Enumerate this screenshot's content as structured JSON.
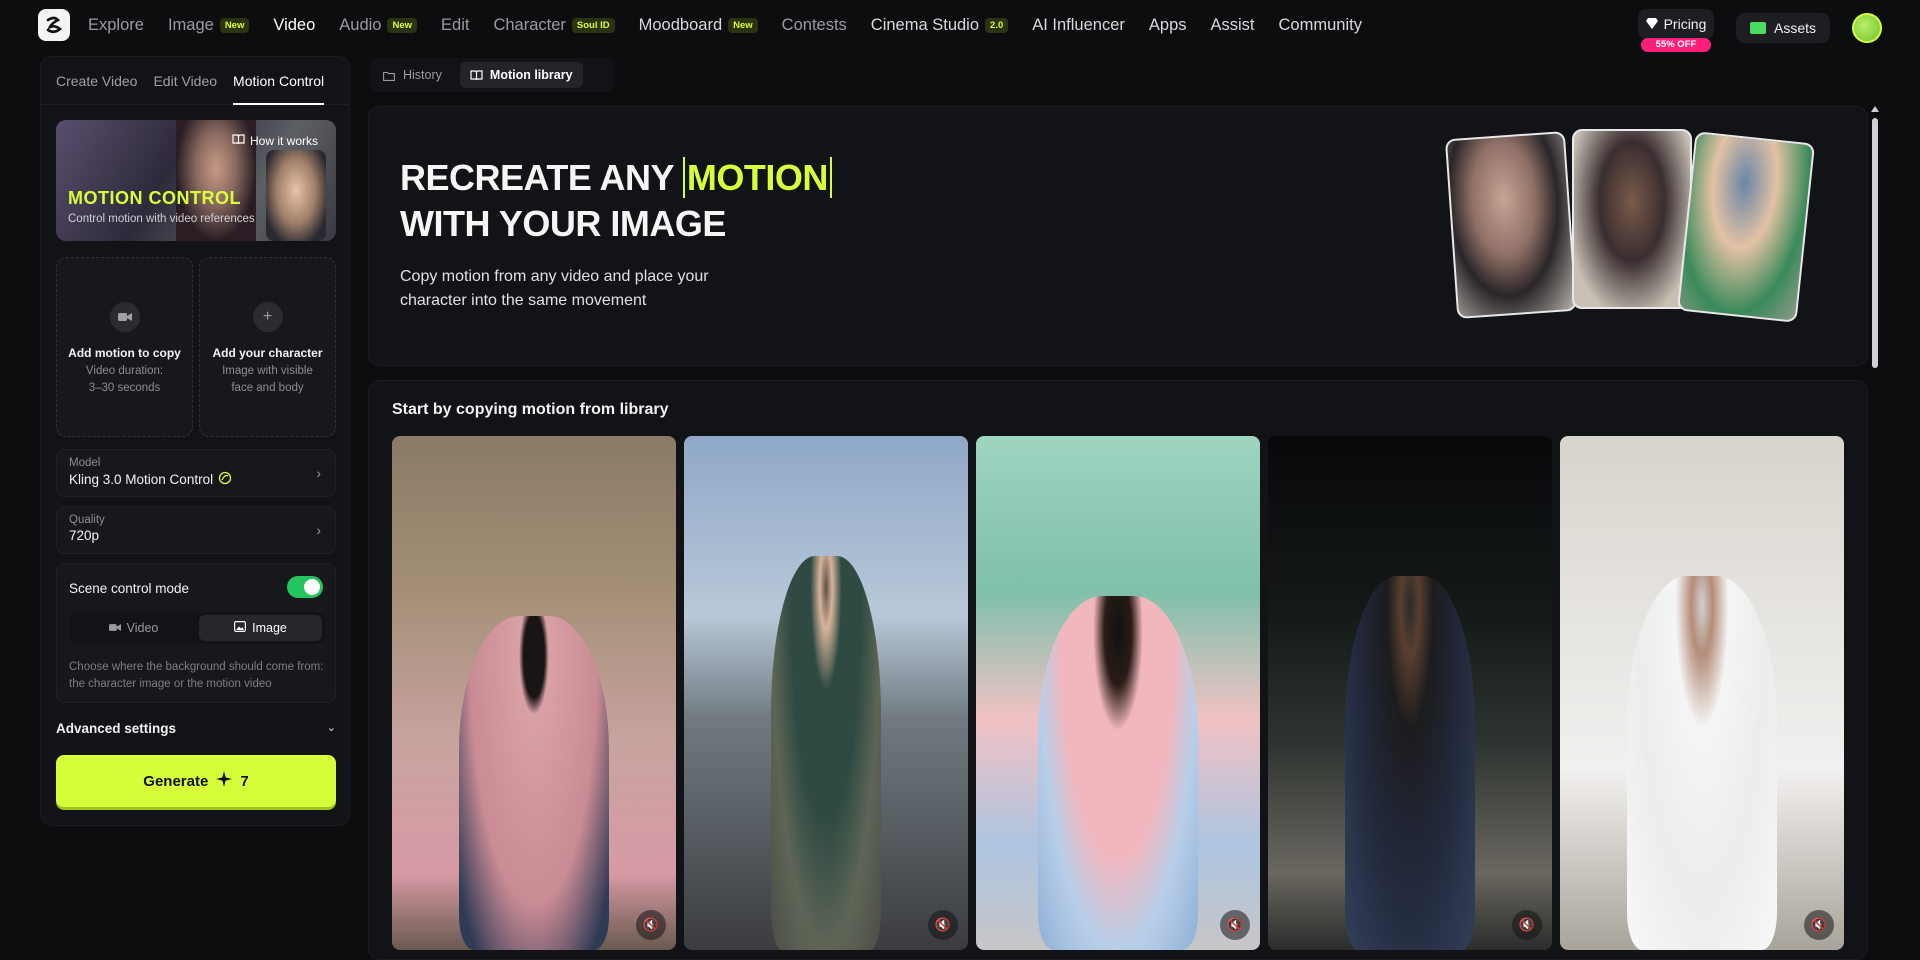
{
  "nav": {
    "items": [
      {
        "label": "Explore",
        "badge": ""
      },
      {
        "label": "Image",
        "badge": "New"
      },
      {
        "label": "Video",
        "badge": ""
      },
      {
        "label": "Audio",
        "badge": "New"
      },
      {
        "label": "Edit",
        "badge": ""
      },
      {
        "label": "Character",
        "badge": "Soul ID"
      },
      {
        "label": "Moodboard",
        "badge": "New"
      },
      {
        "label": "Contests",
        "badge": ""
      },
      {
        "label": "Cinema Studio",
        "badge": "2.0"
      },
      {
        "label": "AI Influencer",
        "badge": ""
      },
      {
        "label": "Apps",
        "badge": ""
      },
      {
        "label": "Assist",
        "badge": ""
      },
      {
        "label": "Community",
        "badge": ""
      }
    ],
    "pricing": "Pricing",
    "pricing_badge": "55% OFF",
    "assets": "Assets"
  },
  "left": {
    "tabs": [
      "Create Video",
      "Edit Video",
      "Motion Control"
    ],
    "hero": {
      "how": "How it works",
      "title": "MOTION CONTROL",
      "subtitle": "Control motion with video references"
    },
    "upload_motion": {
      "title": "Add motion to copy",
      "sub1": "Video duration:",
      "sub2": "3–30 seconds"
    },
    "upload_character": {
      "title": "Add your character",
      "sub1": "Image with visible",
      "sub2": "face and body"
    },
    "model": {
      "label": "Model",
      "value": "Kling 3.0 Motion Control"
    },
    "quality": {
      "label": "Quality",
      "value": "720p"
    },
    "scene": {
      "title": "Scene control mode",
      "video": "Video",
      "image": "Image",
      "desc": "Choose where the background should come from: the character image or the motion video"
    },
    "advanced": "Advanced settings",
    "generate": "Generate",
    "generate_cost": "7"
  },
  "right": {
    "tabs": [
      "History",
      "Motion library"
    ],
    "banner": {
      "line1_pre": "RECREATE ANY ",
      "line1_accent": "MOTION",
      "line2": "WITH YOUR IMAGE",
      "sub": "Copy motion from any video and place your character into the same movement"
    },
    "library_title": "Start by copying motion from library"
  },
  "colors": {
    "accent": "#d6ff3a",
    "toggle_on": "#22c55e",
    "sale": "#ff1f7a"
  }
}
